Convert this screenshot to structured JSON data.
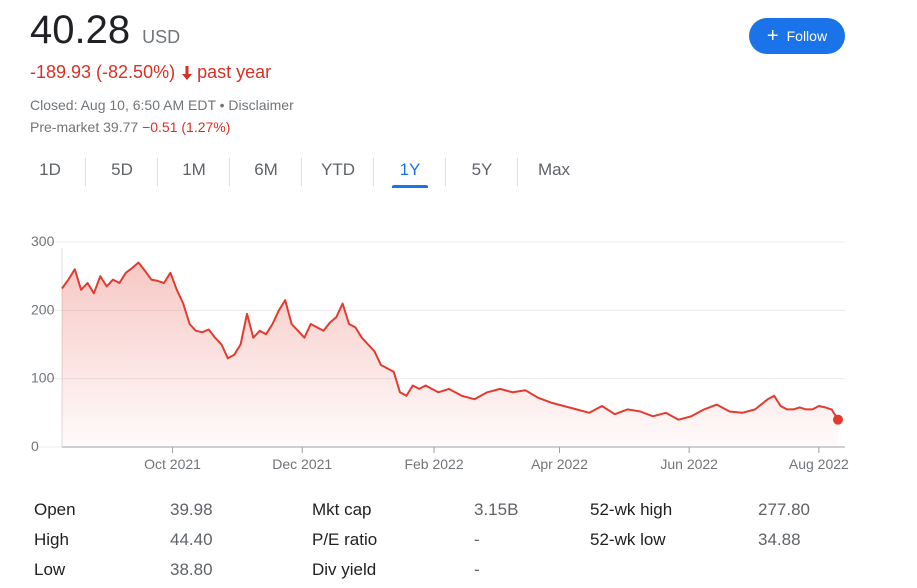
{
  "quote": {
    "price": "40.28",
    "currency": "USD",
    "change": "-189.93 (-82.50%)",
    "period": "past year",
    "closed": "Closed: Aug 10, 6:50 AM EDT • Disclaimer",
    "premarket_label": "Pre-market 39.77",
    "premarket_change": "−0.51 (1.27%)"
  },
  "follow_button": {
    "label": "Follow",
    "color": "#1a73e8"
  },
  "tabs": [
    {
      "label": "1D"
    },
    {
      "label": "5D"
    },
    {
      "label": "1M"
    },
    {
      "label": "6M"
    },
    {
      "label": "YTD"
    },
    {
      "label": "1Y",
      "active": true
    },
    {
      "label": "5Y"
    },
    {
      "label": "Max"
    }
  ],
  "stats": [
    {
      "label": "Open",
      "value": "39.98"
    },
    {
      "label": "High",
      "value": "44.40"
    },
    {
      "label": "Low",
      "value": "38.80"
    },
    {
      "label": "Mkt cap",
      "value": "3.15B"
    },
    {
      "label": "P/E ratio",
      "value": "-"
    },
    {
      "label": "Div yield",
      "value": "-"
    },
    {
      "label": "52-wk high",
      "value": "277.80"
    },
    {
      "label": "52-wk low",
      "value": "34.88"
    }
  ],
  "colors": {
    "line": "#e23b2f",
    "negative": "#d93025",
    "accent": "#1a73e8"
  },
  "chart_data": {
    "type": "line",
    "y_ticks": [
      "0",
      "100",
      "200",
      "300"
    ],
    "x_ticks": [
      "Oct 2021",
      "Dec 2021",
      "Feb 2022",
      "Apr 2022",
      "Jun 2022",
      "Aug 2022"
    ],
    "ylim": [
      0,
      300
    ],
    "xlim": [
      "2021-08-10",
      "2022-08-10"
    ],
    "grid": true,
    "x": [
      "2021-08-10",
      "2021-08-13",
      "2021-08-16",
      "2021-08-19",
      "2021-08-22",
      "2021-08-25",
      "2021-08-28",
      "2021-08-31",
      "2021-09-03",
      "2021-09-06",
      "2021-09-09",
      "2021-09-12",
      "2021-09-15",
      "2021-09-18",
      "2021-09-21",
      "2021-09-24",
      "2021-09-27",
      "2021-09-30",
      "2021-10-03",
      "2021-10-06",
      "2021-10-09",
      "2021-10-12",
      "2021-10-15",
      "2021-10-18",
      "2021-10-21",
      "2021-10-24",
      "2021-10-27",
      "2021-10-30",
      "2021-11-02",
      "2021-11-05",
      "2021-11-08",
      "2021-11-11",
      "2021-11-14",
      "2021-11-17",
      "2021-11-20",
      "2021-11-23",
      "2021-11-26",
      "2021-11-29",
      "2021-12-02",
      "2021-12-05",
      "2021-12-08",
      "2021-12-11",
      "2021-12-14",
      "2021-12-17",
      "2021-12-20",
      "2021-12-23",
      "2021-12-26",
      "2021-12-29",
      "2022-01-01",
      "2022-01-04",
      "2022-01-07",
      "2022-01-10",
      "2022-01-13",
      "2022-01-16",
      "2022-01-19",
      "2022-01-22",
      "2022-01-25",
      "2022-01-28",
      "2022-01-31",
      "2022-02-03",
      "2022-02-08",
      "2022-02-14",
      "2022-02-20",
      "2022-02-26",
      "2022-03-04",
      "2022-03-10",
      "2022-03-16",
      "2022-03-22",
      "2022-03-28",
      "2022-04-03",
      "2022-04-09",
      "2022-04-15",
      "2022-04-21",
      "2022-04-27",
      "2022-05-03",
      "2022-05-09",
      "2022-05-15",
      "2022-05-21",
      "2022-05-27",
      "2022-06-02",
      "2022-06-08",
      "2022-06-14",
      "2022-06-20",
      "2022-06-26",
      "2022-07-02",
      "2022-07-08",
      "2022-07-11",
      "2022-07-14",
      "2022-07-17",
      "2022-07-20",
      "2022-07-23",
      "2022-07-26",
      "2022-07-29",
      "2022-08-01",
      "2022-08-04",
      "2022-08-07",
      "2022-08-10"
    ],
    "values": [
      232,
      245,
      260,
      230,
      240,
      225,
      250,
      235,
      245,
      240,
      255,
      262,
      270,
      258,
      245,
      243,
      240,
      255,
      230,
      210,
      180,
      170,
      168,
      172,
      160,
      150,
      130,
      135,
      150,
      195,
      160,
      170,
      165,
      180,
      200,
      215,
      180,
      170,
      160,
      180,
      175,
      170,
      182,
      190,
      210,
      180,
      175,
      160,
      150,
      140,
      120,
      115,
      110,
      80,
      75,
      90,
      85,
      90,
      85,
      80,
      85,
      75,
      70,
      80,
      85,
      80,
      83,
      72,
      65,
      60,
      55,
      50,
      60,
      48,
      55,
      52,
      45,
      50,
      40,
      45,
      55,
      62,
      52,
      50,
      55,
      70,
      75,
      60,
      55,
      55,
      58,
      55,
      55,
      60,
      58,
      55,
      40
    ]
  }
}
